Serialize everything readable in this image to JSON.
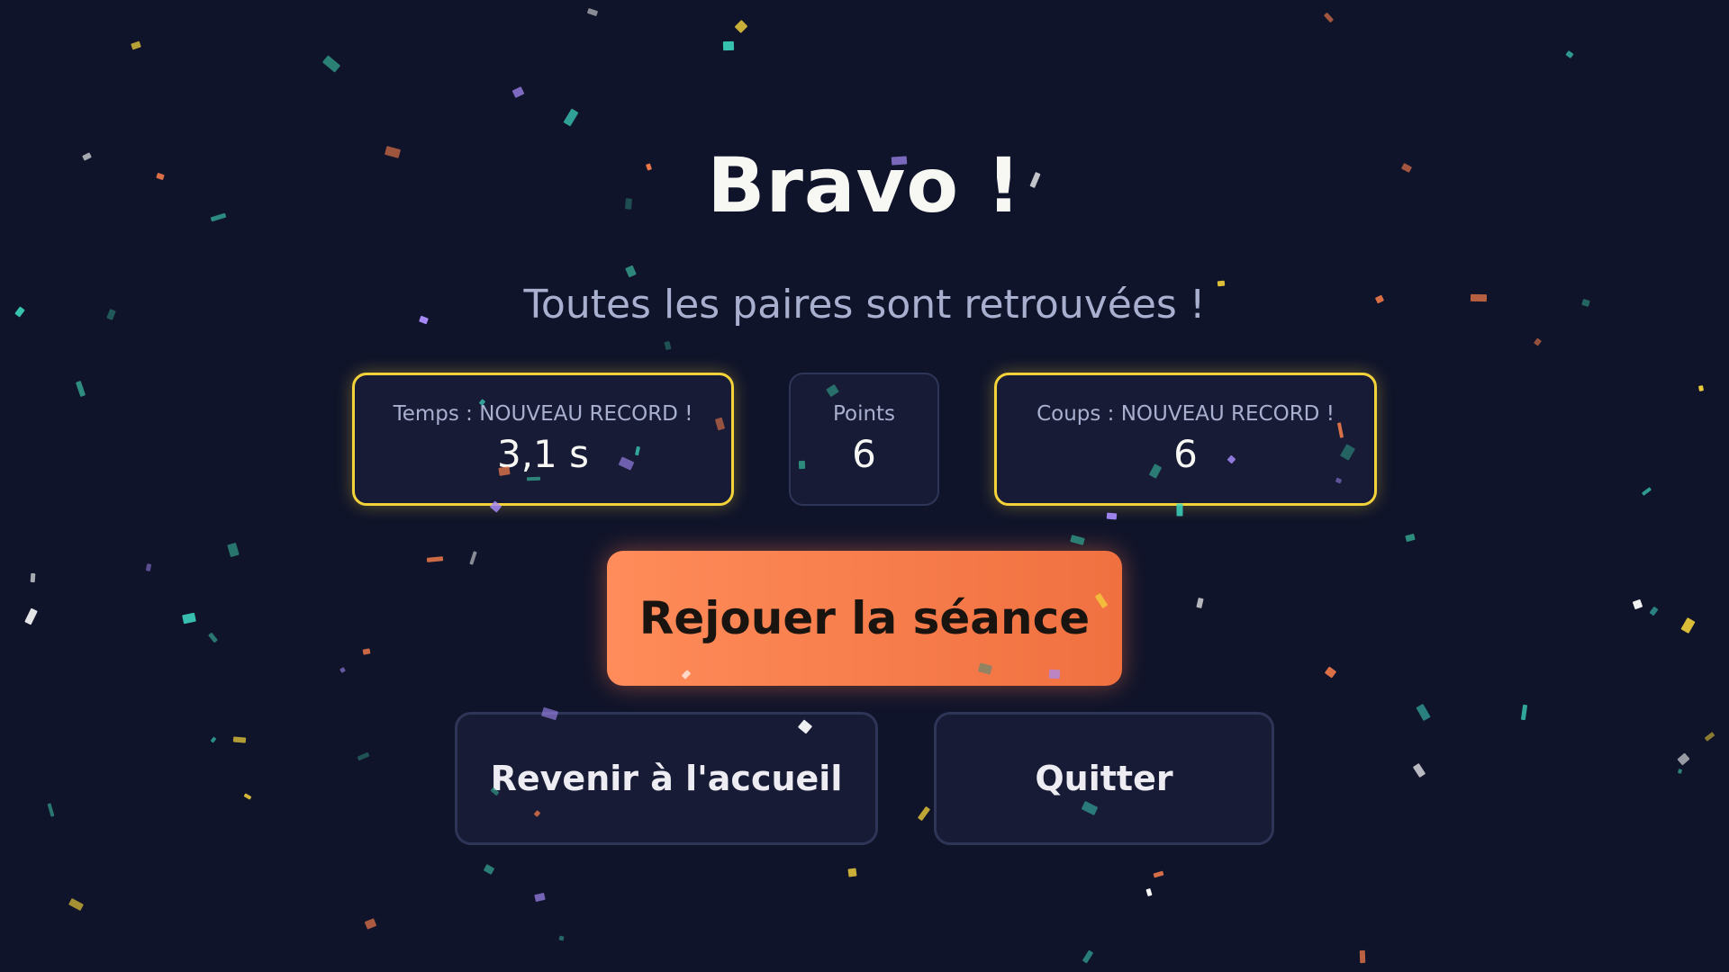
{
  "result": {
    "title": "Bravo !",
    "subtitle": "Toutes les paires sont retrouvées !"
  },
  "stats": {
    "time": {
      "label": "Temps : NOUVEAU RECORD !",
      "value": "3,1 s",
      "is_record": true
    },
    "points": {
      "label": "Points",
      "value": "6",
      "is_record": false
    },
    "moves": {
      "label": "Coups : NOUVEAU RECORD !",
      "value": "6",
      "is_record": true
    }
  },
  "actions": {
    "replay_label": "Rejouer la séance",
    "home_label": "Revenir à l'accueil",
    "quit_label": "Quitter"
  },
  "colors": {
    "background": "#10142a",
    "record_border": "#f3d23a",
    "primary_button": "#ff8c5a",
    "card": "#171b35",
    "confetti": [
      "#f3d23a",
      "#f07a4a",
      "#ffffff",
      "#a78bfa",
      "#3dd6c0",
      "#2f8f80"
    ]
  }
}
